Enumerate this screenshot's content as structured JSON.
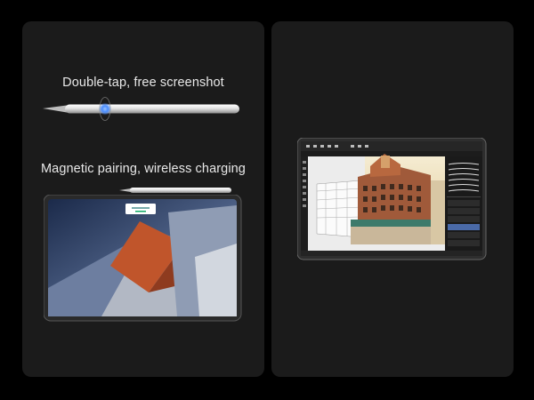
{
  "left_card": {
    "feature_1": "Double-tap, free screenshot",
    "feature_2": "Magnetic pairing, wireless charging"
  },
  "right_card": {},
  "colors": {
    "page_background": "#000000",
    "card_background": "#1b1b1b",
    "text": "#e8e8e8",
    "double_tap_glow": "#4a8dff"
  },
  "icons": {
    "stylus": "stylus-pen-icon",
    "tap_indicator": "double-tap-ripple-icon",
    "tablet": "tablet-icon"
  }
}
